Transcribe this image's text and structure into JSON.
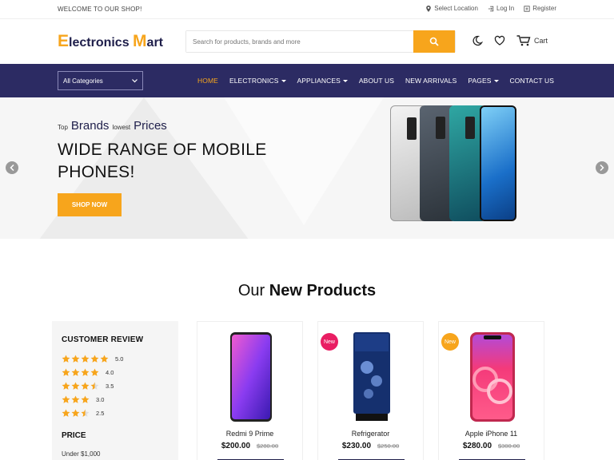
{
  "topbar": {
    "welcome": "WELCOME TO OUR SHOP!",
    "select_location": "Select Location",
    "login": "Log In",
    "register": "Register"
  },
  "header": {
    "logo_e": "E",
    "logo_lectronics": "lectronics ",
    "logo_m": "M",
    "logo_art": "art",
    "search_placeholder": "Search for products, brands and more",
    "cart_label": "Cart"
  },
  "nav": {
    "category_select": "All Categories",
    "menu": [
      {
        "label": "HOME",
        "dropdown": false,
        "active": true
      },
      {
        "label": "ELECTRONICS",
        "dropdown": true,
        "active": false
      },
      {
        "label": "APPLIANCES",
        "dropdown": true,
        "active": false
      },
      {
        "label": "ABOUT US",
        "dropdown": false,
        "active": false
      },
      {
        "label": "NEW ARRIVALS",
        "dropdown": false,
        "active": false
      },
      {
        "label": "PAGES",
        "dropdown": true,
        "active": false
      },
      {
        "label": "CONTACT US",
        "dropdown": false,
        "active": false
      }
    ]
  },
  "hero": {
    "top": "Top",
    "brands": "Brands",
    "lowest": "lowest",
    "prices": "Prices",
    "headline": "WIDE RANGE OF MOBILE PHONES!",
    "cta": "SHOP NOW"
  },
  "products_section": {
    "title_light": "Our",
    "title_bold": "New Products"
  },
  "filter": {
    "review_title": "CUSTOMER REVIEW",
    "ratings": [
      {
        "stars": 5,
        "label": "5.0"
      },
      {
        "stars": 4,
        "label": "4.0"
      },
      {
        "stars": 3.5,
        "label": "3.5"
      },
      {
        "stars": 3,
        "label": "3.0"
      },
      {
        "stars": 2.5,
        "label": "2.5"
      }
    ],
    "price_title": "PRICE",
    "price_option": "Under $1,000"
  },
  "products": [
    {
      "name": "Redmi 9 Prime",
      "price": "$200.00",
      "old_price": "$280.00",
      "badge": ""
    },
    {
      "name": "Refrigerator",
      "price": "$230.00",
      "old_price": "$250.00",
      "badge": "New"
    },
    {
      "name": "Apple iPhone 11",
      "price": "$280.00",
      "old_price": "$300.00",
      "badge": "New"
    }
  ],
  "colors": {
    "accent": "#f7a51c",
    "nav_bg": "#2c2b63",
    "badge_pink": "#e91e63",
    "badge_yellow": "#f7a51c"
  }
}
